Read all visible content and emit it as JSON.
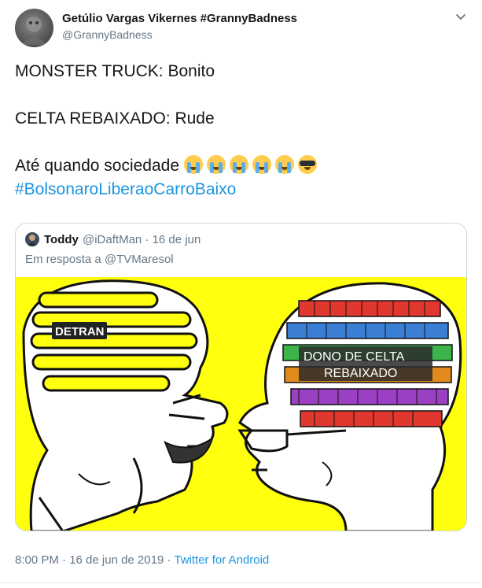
{
  "author": {
    "name": "Getúlio Vargas Vikernes #GrannyBadness",
    "handle": "@GrannyBadness"
  },
  "tweet": {
    "line1": "MONSTER TRUCK: Bonito",
    "line2": "CELTA REBAIXADO: Rude",
    "line3": "Até quando sociedade",
    "emojis": [
      "loudly-crying-face",
      "loudly-crying-face",
      "loudly-crying-face",
      "loudly-crying-face",
      "loudly-crying-face",
      "smiling-face-with-sunglasses"
    ],
    "hashtag": "#BolsonaroLiberaoCarroBaixo"
  },
  "quoted": {
    "name": "Toddy",
    "handle_time": "@iDaftMan · 16 de jun",
    "reply_to": "Em resposta a @TVMaresol",
    "image": {
      "left_label": "DETRAN",
      "right_label_line1": "DONO DE CELTA",
      "right_label_line2": "REBAIXADO",
      "background": "#ffff0e"
    }
  },
  "meta": {
    "timestamp": "8:00 PM · 16 de jun de 2019 · ",
    "source": "Twitter for Android"
  },
  "colors": {
    "link": "#1b95e0",
    "secondary": "#657786",
    "border": "#ccd6dd"
  }
}
